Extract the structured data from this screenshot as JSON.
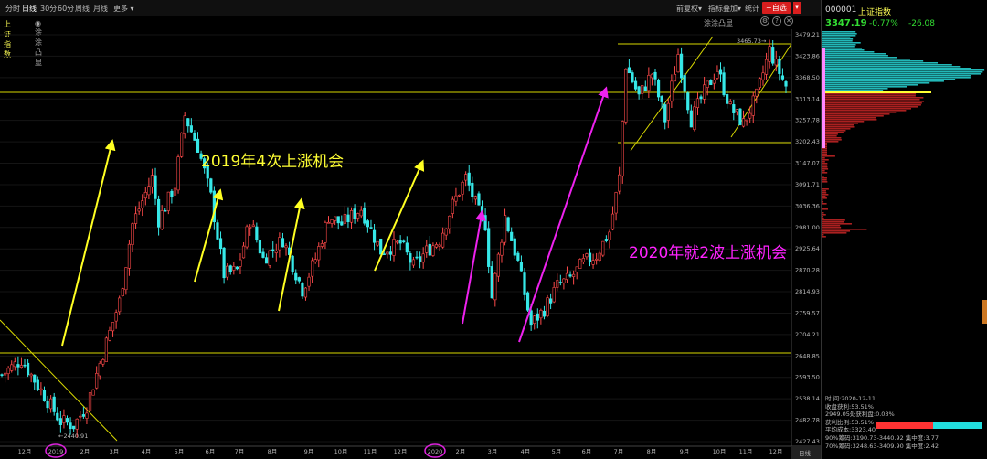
{
  "toolbar": {
    "tabs": [
      "分时",
      "日线",
      "30分",
      "60分",
      "周线",
      "月线"
    ],
    "more": "更多",
    "restore": "前复权",
    "overlay": "指标叠加",
    "statistics": "统计",
    "add_watch": "+自选"
  },
  "subbar": {
    "index_name": "上证指数",
    "chip_marker": "涂涂凸显",
    "chip_marker_right": "涂涂凸显"
  },
  "panel": {
    "code": "000001",
    "name": "上证指数",
    "price": "3347.19",
    "pct": "-0.77%",
    "change": "-26.08",
    "stats": [
      "时     间:2020-12-11",
      "收盘获利:53.51%",
      "2949.05处获利盘:0.03%",
      "获利比例:53.51%",
      "平均成本:3323.40",
      "90%筹码:3190.73-3440.92  集中度:3.77",
      "70%筹码:3248.63-3409.90  集中度:2.42"
    ]
  },
  "annotations": {
    "y2019": "2019年4次上涨机会",
    "y2020": "2020年就2波上涨机会",
    "high_label": "3465.73→",
    "low_label": "←2440.91"
  },
  "chart_data": {
    "type": "candlestick",
    "title": "上证指数",
    "y_ticks": [
      "3479.21",
      "3423.86",
      "3368.50",
      "3313.14",
      "3257.78",
      "3202.43",
      "3147.07",
      "3091.71",
      "3036.36",
      "2981.00",
      "2925.64",
      "2870.28",
      "2814.93",
      "2759.57",
      "2704.21",
      "2648.85",
      "2593.50",
      "2538.14",
      "2482.78",
      "2427.43"
    ],
    "x_ticks": [
      "12月",
      "2019",
      "2月",
      "3月",
      "4月",
      "5月",
      "6月",
      "7月",
      "8月",
      "9月",
      "10月",
      "11月",
      "12月",
      "2020",
      "2月",
      "3月",
      "4月",
      "5月",
      "6月",
      "7月",
      "8月",
      "9月",
      "10月",
      "11月",
      "12月"
    ],
    "x_axis_label": "日线",
    "high": 3465.73,
    "low": 2440.91,
    "path": [
      [
        0,
        2600
      ],
      [
        6,
        2640
      ],
      [
        12,
        2560
      ],
      [
        18,
        2480
      ],
      [
        22,
        2470
      ],
      [
        26,
        2520
      ],
      [
        30,
        2630
      ],
      [
        36,
        2790
      ],
      [
        40,
        2990
      ],
      [
        46,
        3110
      ],
      [
        48,
        3000
      ],
      [
        53,
        3090
      ],
      [
        56,
        3270
      ],
      [
        60,
        3190
      ],
      [
        64,
        3060
      ],
      [
        68,
        2860
      ],
      [
        72,
        2870
      ],
      [
        76,
        3000
      ],
      [
        80,
        2900
      ],
      [
        86,
        2950
      ],
      [
        92,
        2820
      ],
      [
        96,
        2900
      ],
      [
        100,
        3010
      ],
      [
        104,
        2990
      ],
      [
        110,
        3030
      ],
      [
        116,
        2920
      ],
      [
        122,
        2940
      ],
      [
        126,
        2880
      ],
      [
        130,
        2920
      ],
      [
        134,
        2950
      ],
      [
        138,
        3040
      ],
      [
        142,
        3110
      ],
      [
        146,
        3020
      ],
      [
        148,
        2990
      ],
      [
        150,
        2800
      ],
      [
        154,
        3010
      ],
      [
        158,
        2890
      ],
      [
        162,
        2730
      ],
      [
        166,
        2770
      ],
      [
        170,
        2830
      ],
      [
        174,
        2850
      ],
      [
        178,
        2890
      ],
      [
        182,
        2910
      ],
      [
        186,
        2970
      ],
      [
        189,
        3110
      ],
      [
        191,
        3400
      ],
      [
        195,
        3320
      ],
      [
        199,
        3380
      ],
      [
        203,
        3260
      ],
      [
        207,
        3430
      ],
      [
        211,
        3260
      ],
      [
        215,
        3330
      ],
      [
        219,
        3390
      ],
      [
        223,
        3290
      ],
      [
        227,
        3250
      ],
      [
        231,
        3320
      ],
      [
        235,
        3440
      ],
      [
        237,
        3400
      ],
      [
        240,
        3347
      ]
    ]
  }
}
